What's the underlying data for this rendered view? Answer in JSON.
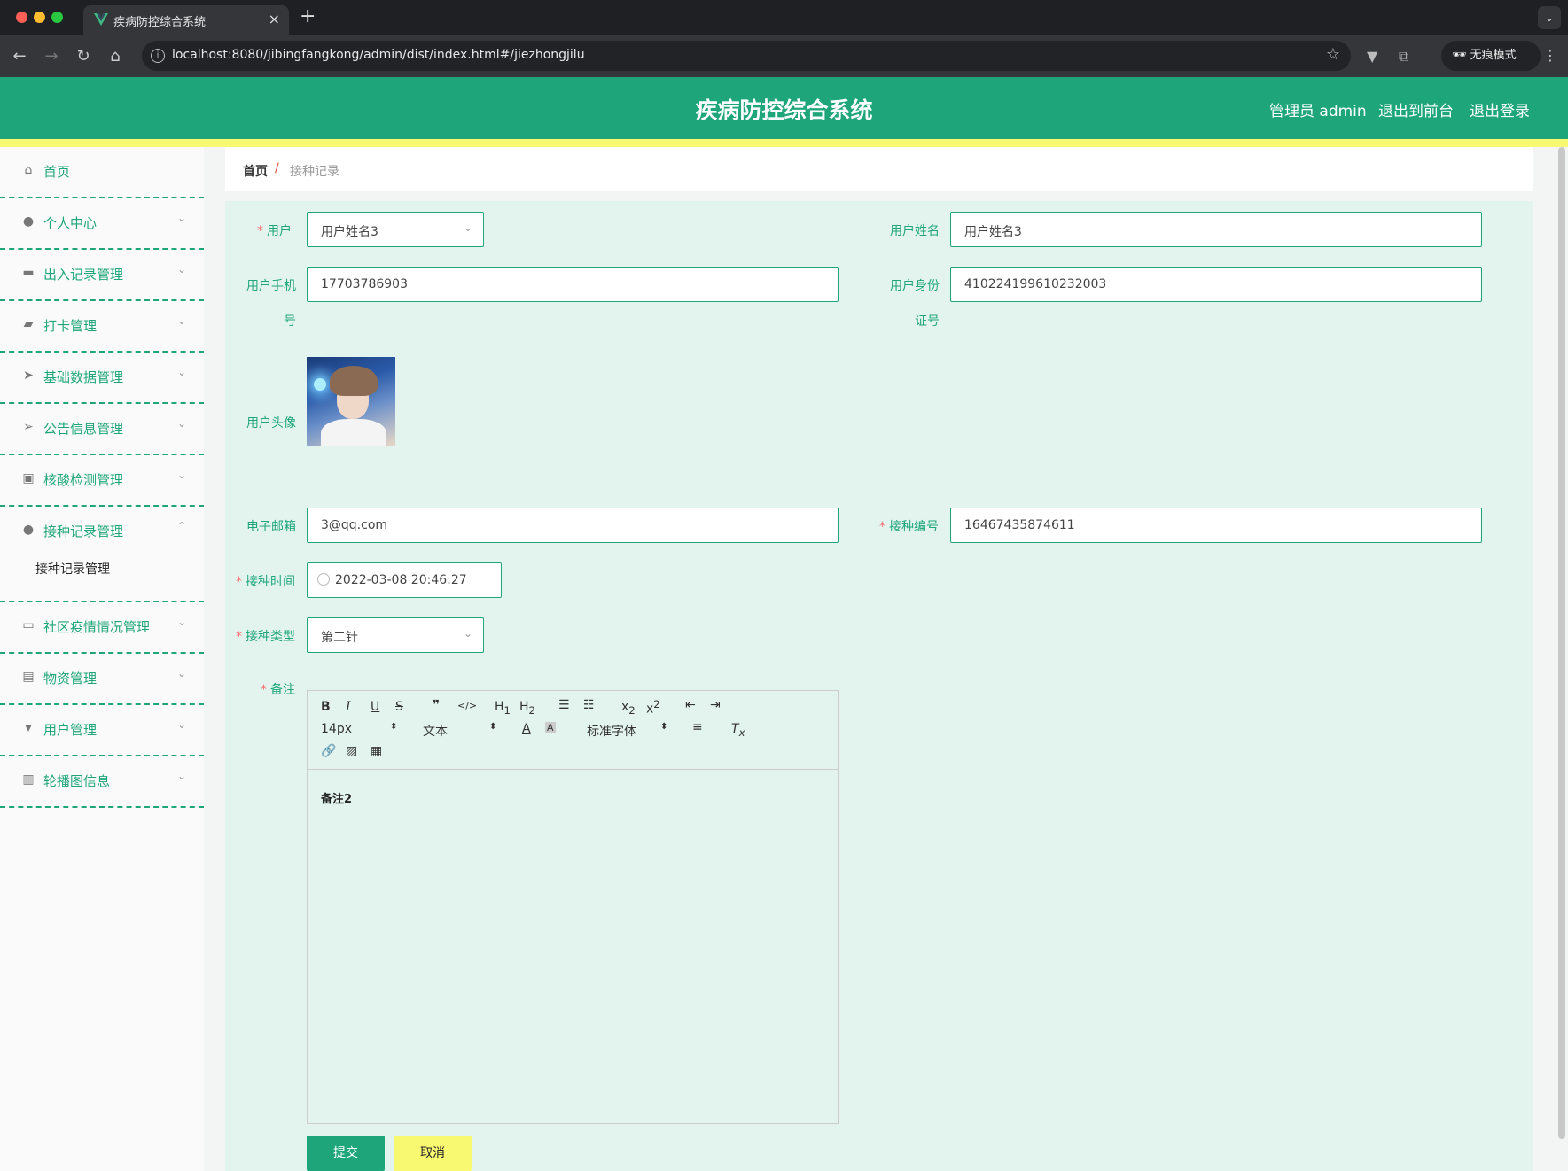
{
  "browser": {
    "tab_title": "疾病防控综合系统",
    "url": "localhost:8080/jibingfangkong/admin/dist/index.html#/jiezhongjilu",
    "incognito_label": "无痕模式",
    "traffic_colors": [
      "#ff5f57",
      "#febc2e",
      "#28c840"
    ]
  },
  "header": {
    "title": "疾病防控综合系统",
    "user": "管理员 admin",
    "to_front": "退出到前台",
    "logout": "退出登录",
    "accent": "#1ea67a",
    "bar_color": "#f9f871"
  },
  "sidebar": {
    "items": [
      {
        "label": "首页",
        "icon": "home-icon"
      },
      {
        "label": "个人中心",
        "icon": "user-icon"
      },
      {
        "label": "出入记录管理",
        "icon": "tray-icon"
      },
      {
        "label": "打卡管理",
        "icon": "wallet-icon"
      },
      {
        "label": "基础数据管理",
        "icon": "send-icon"
      },
      {
        "label": "公告信息管理",
        "icon": "location-icon"
      },
      {
        "label": "核酸检测管理",
        "icon": "suitcase-icon"
      },
      {
        "label": "接种记录管理",
        "icon": "user-icon"
      },
      {
        "label": "社区疫情情况管理",
        "icon": "chat-icon"
      },
      {
        "label": "物资管理",
        "icon": "message-icon"
      },
      {
        "label": "用户管理",
        "icon": "stamp-icon"
      },
      {
        "label": "轮播图信息",
        "icon": "bar-chart-icon"
      }
    ],
    "submenu": "接种记录管理"
  },
  "breadcrumb": {
    "home": "首页",
    "separator": "/",
    "current": "接种记录"
  },
  "form": {
    "user_label": "用户",
    "user_value": "用户姓名3",
    "username_label": "用户姓名",
    "username_value": "用户姓名3",
    "phone_label_1": "用户手机",
    "phone_label_2": "号",
    "phone_value": "17703786903",
    "idcard_label_1": "用户身份",
    "idcard_label_2": "证号",
    "idcard_value": "410224199610232003",
    "avatar_label": "用户头像",
    "email_label": "电子邮箱",
    "email_value": "3@qq.com",
    "vacc_no_label": "接种编号",
    "vacc_no_value": "16467435874611",
    "vacc_time_label": "接种时间",
    "vacc_time_value": "2022-03-08 20:46:27",
    "vacc_type_label": "接种类型",
    "vacc_type_value": "第二针",
    "remark_label": "备注",
    "remark_value": "备注2",
    "required_mark": "*"
  },
  "editor": {
    "font_size": "14px",
    "format": "文本",
    "font_family": "标准字体"
  },
  "buttons": {
    "submit": "提交",
    "cancel": "取消"
  }
}
